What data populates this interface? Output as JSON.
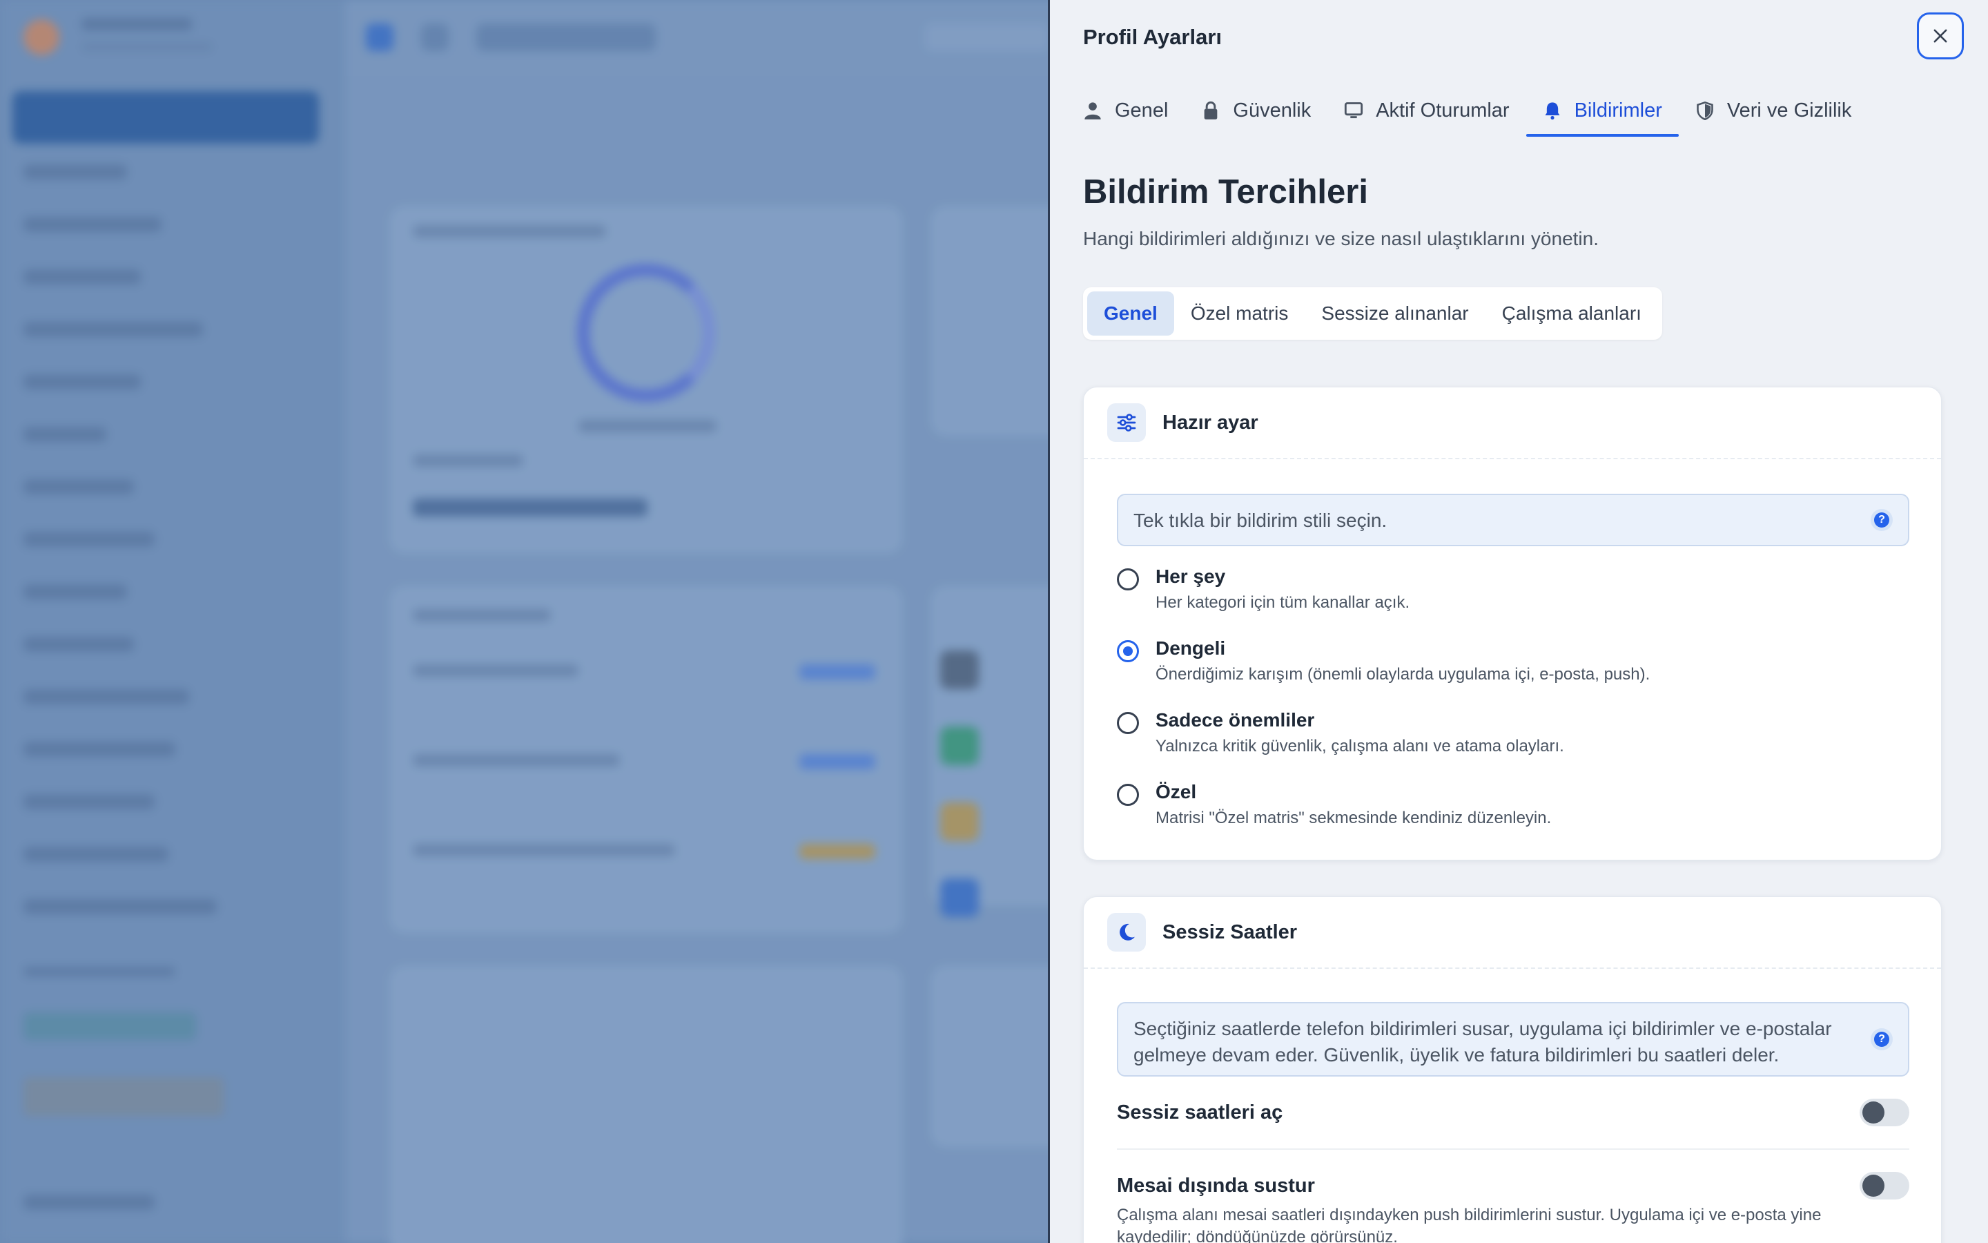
{
  "panel": {
    "title": "Profil Ayarları",
    "close_icon": "close-icon"
  },
  "tabs": [
    {
      "label": "Genel",
      "icon": "user-icon",
      "active": false
    },
    {
      "label": "Güvenlik",
      "icon": "lock-icon",
      "active": false
    },
    {
      "label": "Aktif Oturumlar",
      "icon": "monitor-icon",
      "active": false
    },
    {
      "label": "Bildirimler",
      "icon": "bell-icon",
      "active": true
    },
    {
      "label": "Veri ve Gizlilik",
      "icon": "shield-icon",
      "active": false
    }
  ],
  "section": {
    "heading": "Bildirim Tercihleri",
    "description": "Hangi bildirimleri aldığınızı ve size nasıl ulaştıklarını yönetin."
  },
  "segments": [
    {
      "label": "Genel",
      "active": true
    },
    {
      "label": "Özel matris",
      "active": false
    },
    {
      "label": "Sessize alınanlar",
      "active": false
    },
    {
      "label": "Çalışma alanları",
      "active": false
    }
  ],
  "preset_card": {
    "title": "Hazır ayar",
    "icon": "sliders-icon",
    "info": "Tek tıkla bir bildirim stili seçin.",
    "options": [
      {
        "label": "Her şey",
        "description": "Her kategori için tüm kanallar açık.",
        "checked": false
      },
      {
        "label": "Dengeli",
        "description": "Önerdiğimiz karışım (önemli olaylarda uygulama içi, e-posta, push).",
        "checked": true
      },
      {
        "label": "Sadece önemliler",
        "description": "Yalnızca kritik güvenlik, çalışma alanı ve atama olayları.",
        "checked": false
      },
      {
        "label": "Özel",
        "description": "Matrisi \"Özel matris\" sekmesinde kendiniz düzenleyin.",
        "checked": false
      }
    ]
  },
  "quiet_card": {
    "title": "Sessiz Saatler",
    "icon": "moon-icon",
    "info": "Seçtiğiniz saatlerde telefon bildirimleri susar, uygulama içi bildirimler ve e-postalar gelmeye devam eder. Güvenlik, üyelik ve fatura bildirimleri bu saatleri deler.",
    "settings": [
      {
        "label": "Sessiz saatleri aç",
        "description": "",
        "enabled": false
      },
      {
        "label": "Mesai dışında sustur",
        "description": "Çalışma alanı mesai saatleri dışındayken push bildirimlerini sustur. Uygulama içi ve e-posta yine kaydedilir; döndüğünüzde görürsünüz.",
        "enabled": false
      }
    ]
  },
  "colors": {
    "accent": "#2563eb",
    "panel_bg": "#eef1f6",
    "card_bg": "#ffffff",
    "info_bg": "#eaf1fb"
  }
}
